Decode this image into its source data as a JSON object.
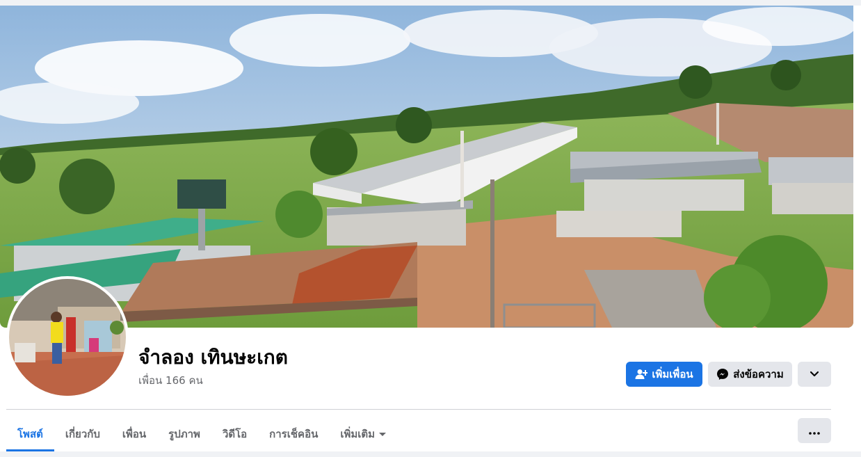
{
  "profile": {
    "name": "จำลอง เทินษะเกต",
    "friend_count": "เพื่อน 166 คน"
  },
  "actions": {
    "add_friend": "เพิ่มเพื่อน",
    "message": "ส่งข้อความ"
  },
  "tabs": [
    {
      "label": "โพสต์",
      "active": true
    },
    {
      "label": "เกี่ยวกับ",
      "active": false
    },
    {
      "label": "เพื่อน",
      "active": false
    },
    {
      "label": "รูปภาพ",
      "active": false
    },
    {
      "label": "วิดีโอ",
      "active": false
    },
    {
      "label": "การเช็คอิน",
      "active": false
    },
    {
      "label": "เพิ่มเติม",
      "active": false
    }
  ],
  "icons": {
    "add_friend": "person-plus-icon",
    "message": "messenger-icon",
    "dropdown": "chevron-down-icon",
    "more_tab": "caret-down-icon",
    "overflow": "ellipsis-icon"
  },
  "colors": {
    "accent": "#1b74e4",
    "secondary_button": "#e4e6eb",
    "muted_text": "#65676b"
  }
}
